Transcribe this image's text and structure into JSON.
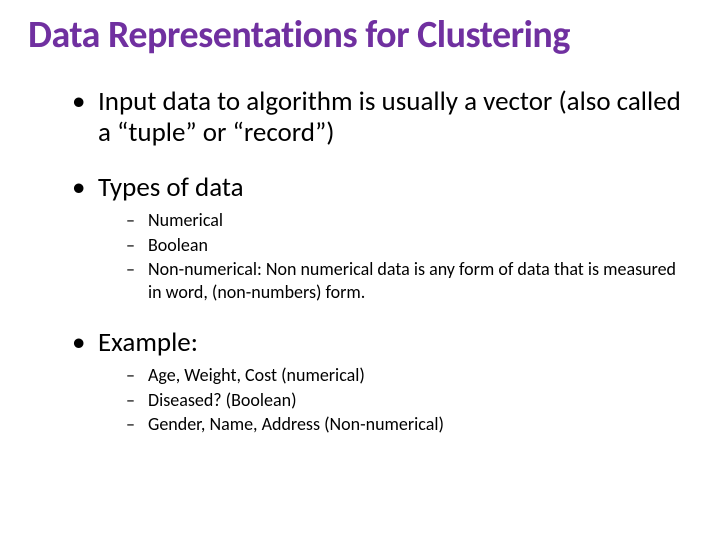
{
  "title": "Data Representations for Clustering",
  "bullets": [
    {
      "text": "Input data to algorithm is usually a vector (also called a “tuple” or “record”)",
      "sub": []
    },
    {
      "text": "Types of data",
      "sub": [
        "Numerical",
        "Boolean",
        "Non-numerical: Non numerical data is any form of data that is measured in word, (non-numbers) form."
      ]
    },
    {
      "text": "Example:",
      "sub": [
        "Age, Weight, Cost (numerical)",
        "Diseased? (Boolean)",
        "Gender, Name, Address (Non-numerical)"
      ]
    }
  ]
}
